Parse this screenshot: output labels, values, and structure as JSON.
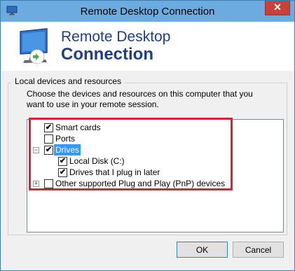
{
  "window": {
    "title": "Remote Desktop Connection",
    "close_glyph": "✕"
  },
  "header": {
    "line1": "Remote Desktop",
    "line2": "Connection"
  },
  "group": {
    "legend": "Local devices and resources",
    "description": "Choose the devices and resources on this computer that you want to use in your remote session."
  },
  "tree": {
    "items": [
      {
        "label": "Smart cards",
        "checked": true
      },
      {
        "label": "Ports",
        "checked": false
      },
      {
        "label": "Drives",
        "checked": true,
        "expanded": true,
        "selected": true
      },
      {
        "label": "Local Disk (C:)",
        "checked": true
      },
      {
        "label": "Drives that I plug in later",
        "checked": true
      },
      {
        "label": "Other supported Plug and Play (PnP) devices",
        "checked": false,
        "expanded": false
      }
    ]
  },
  "buttons": {
    "ok": "OK",
    "cancel": "Cancel"
  },
  "check_glyph": "✔",
  "expander_glyphs": {
    "expanded": "−",
    "collapsed": "+"
  },
  "colors": {
    "titlebar": "#6cabe0",
    "header_text": "#1e3f86",
    "highlight_border": "#e02031",
    "selection": "#3399ff"
  }
}
